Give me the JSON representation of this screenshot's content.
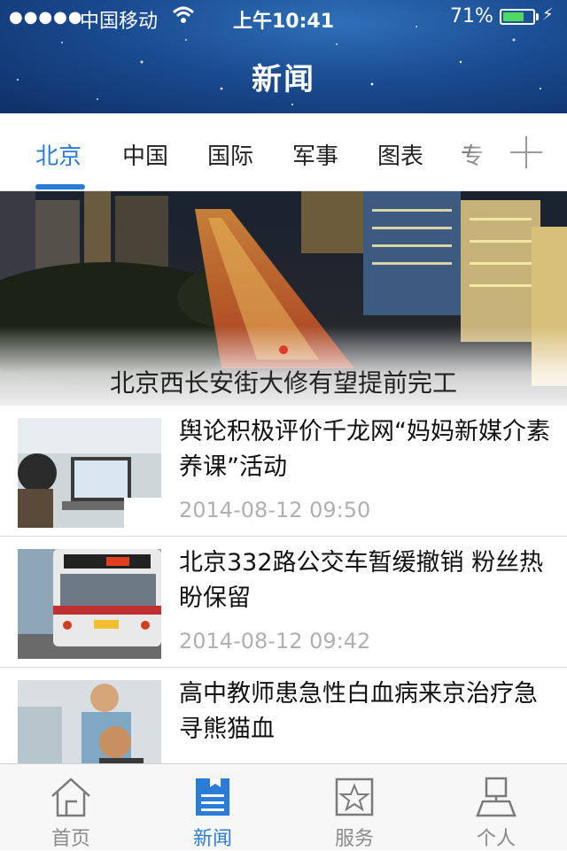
{
  "status_bar": {
    "signal": "●●●●●",
    "carrier": "中国移动",
    "time": "上午10:41",
    "battery_percent": "71%",
    "battery_level": 0.71
  },
  "header": {
    "title": "新闻"
  },
  "tabs": [
    {
      "label": "北京",
      "active": true
    },
    {
      "label": "中国",
      "active": false
    },
    {
      "label": "国际",
      "active": false
    },
    {
      "label": "军事",
      "active": false
    },
    {
      "label": "图表",
      "active": false
    },
    {
      "label": "专",
      "active": false
    }
  ],
  "hero": {
    "title": "北京西长安街大修有望提前完工"
  },
  "news": [
    {
      "title": "舆论积极评价千龙网“妈妈新媒介素养课”活动",
      "date": "2014-08-12 09:50"
    },
    {
      "title": "北京332路公交车暂缓撤销 粉丝热盼保留",
      "date": "2014-08-12 09:42"
    },
    {
      "title": "高中教师患急性白血病来京治疗急寻熊猫血",
      "date": ""
    }
  ],
  "bottom_nav": [
    {
      "label": "首页",
      "icon": "home-icon",
      "active": false
    },
    {
      "label": "新闻",
      "icon": "news-icon",
      "active": true
    },
    {
      "label": "服务",
      "icon": "star-icon",
      "active": false
    },
    {
      "label": "个人",
      "icon": "user-icon",
      "active": false
    }
  ],
  "colors": {
    "accent": "#2b7cd6",
    "header_bg": "#1a4c92",
    "date_text": "#b0b0b0",
    "battery": "#4cd964"
  }
}
